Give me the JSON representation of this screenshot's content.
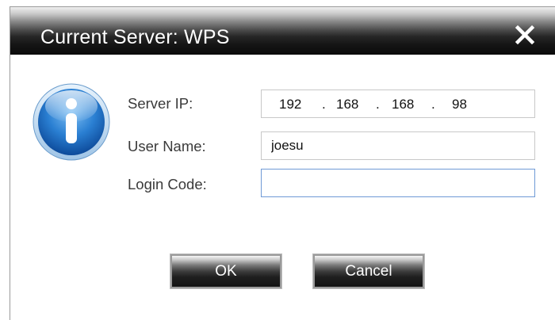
{
  "dialog": {
    "title": "Current Server: WPS",
    "close_icon": "close-icon"
  },
  "icon": "info-icon",
  "form": {
    "server_ip_label": "Server IP:",
    "server_ip": {
      "octet1": "192",
      "octet2": "168",
      "octet3": "168",
      "octet4": "98",
      "separator": "."
    },
    "user_name_label": "User Name:",
    "user_name_value": "joesu",
    "login_code_label": "Login Code:",
    "login_code_value": ""
  },
  "buttons": {
    "ok_label": "OK",
    "cancel_label": "Cancel"
  },
  "colors": {
    "titlebar_dark": "#0b0b0b",
    "info_blue": "#1e6ec8",
    "focus_border": "#6f9ad6"
  }
}
